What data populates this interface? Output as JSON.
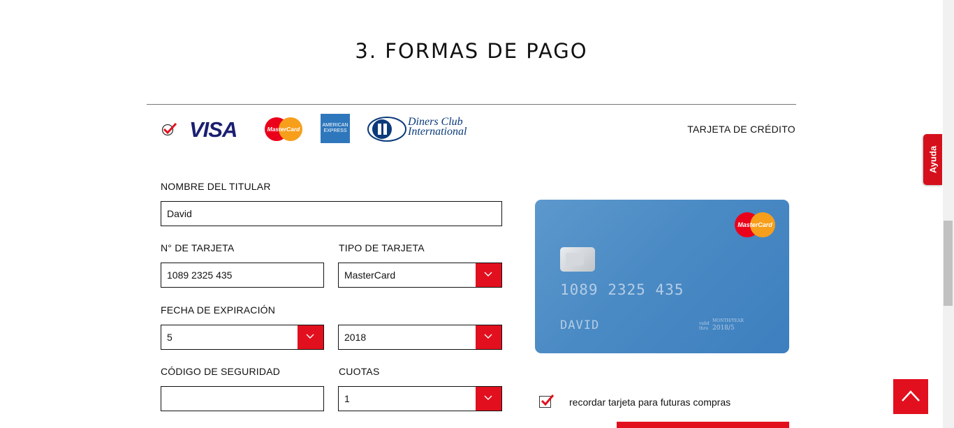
{
  "section_title": "3. FORMAS DE PAGO",
  "payment_methods": {
    "logos": [
      "VISA",
      "MasterCard",
      "AMERICAN EXPRESS",
      "Diners Club International"
    ],
    "visa": "VISA",
    "mastercard": "MasterCard",
    "amex_line1": "AMERICAN",
    "amex_line2": "EXPRESS",
    "diners_line1": "Diners Club",
    "diners_line2": "International",
    "selected_type": "TARJETA DE CRÉDITO"
  },
  "form": {
    "holder_label": "NOMBRE DEL TITULAR",
    "holder_value": "David",
    "card_number_label": "N° DE TARJETA",
    "card_number_value": "1089 2325 435",
    "card_type_label": "TIPO DE TARJETA",
    "card_type_value": "MasterCard",
    "expiry_label": "FECHA DE EXPIRACIÓN",
    "expiry_month": "5",
    "expiry_year": "2018",
    "security_label": "CÓDIGO DE SEGURIDAD",
    "security_value": "",
    "installments_label": "CUOTAS",
    "installments_value": "1"
  },
  "card_preview": {
    "brand": "MasterCard",
    "number": "1089 2325 435",
    "name": "DAVID",
    "valid_line1": "valid",
    "valid_line2": "thru",
    "exp_label": "MONTH/YEAR",
    "exp": "2018/5"
  },
  "remember": {
    "label": "recordar tarjeta para futuras compras",
    "checked": true
  },
  "help_tab": "Ayuda",
  "colors": {
    "accent": "#e2101e",
    "card": "#4a8ac4"
  }
}
